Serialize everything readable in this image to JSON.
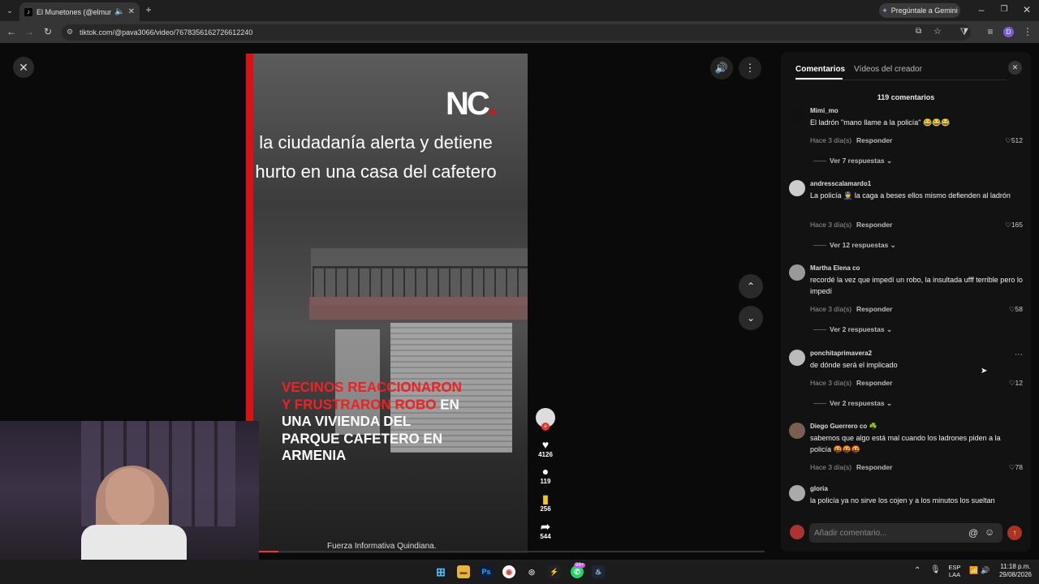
{
  "browser": {
    "tab_title": "El Munetones (@elmunetones)",
    "tab_icon": "tiktok-icon",
    "new_tab": "+",
    "gemini_label": "Pregúntale a Gemini",
    "url": "tiktok.com/@pava3066/video/7678356162726612240",
    "profile_initial": "D"
  },
  "video": {
    "brand_nc": "NC",
    "brand_dot": ".",
    "caption": "la ciudadanía alerta y detiene hurto en una casa del cafetero",
    "headline_red": "VECINOS REACCIONARON Y FRUSTRARON ROBO",
    "headline_white": " EN UNA VIVIENDA DEL PARQUE CAFETERO EN ARMENIA",
    "credit": "Fuerza Informativa Quindiana.",
    "progress_fraction": 0.04,
    "actions": {
      "likes": "4126",
      "comments": "119",
      "saves": "256",
      "shares": "544"
    }
  },
  "panel": {
    "tab_comments": "Comentarios",
    "tab_creator": "Vídeos del creador",
    "count": "119 comentarios",
    "input_placeholder": "Añadir comentario...",
    "reply_label": "Responder",
    "comments": [
      {
        "user": "Mimi_mo",
        "text": "El ladrón \"mano llame a la policía\" 😂😂😂",
        "time": "Hace 3 día(s)",
        "likes": "512",
        "replies": "Ver 7 respuestas"
      },
      {
        "user": "andresscalamardo1",
        "text": "La policía 👮 la caga a beses ellos mismo defienden al ladrón",
        "time": "Hace 3 día(s)",
        "likes": "165",
        "replies": "Ver 12 respuestas"
      },
      {
        "user": "Martha Elena co",
        "text": "recordé la vez que impedí un robo, la insultada ufff terrible pero lo impedí",
        "time": "Hace 3 día(s)",
        "likes": "58",
        "replies": "Ver 2 respuestas"
      },
      {
        "user": "ponchitaprimavera2",
        "text": "de dónde será el implicado",
        "time": "Hace 3 día(s)",
        "likes": "12",
        "replies": "Ver 2 respuestas"
      },
      {
        "user": "Diego Guerrero co ☘️",
        "text": "sabemos que algo está mal cuando los ladrones piden a la policía 🤬🤬🤬",
        "time": "Hace 3 día(s)",
        "likes": "78",
        "replies": ""
      },
      {
        "user": "gloria",
        "text": "la policía ya no sirve los cojen y a los minutos los sueltan",
        "time": "",
        "likes": "",
        "replies": ""
      }
    ]
  },
  "taskbar": {
    "lang_top": "ESP",
    "lang_bottom": "LAA",
    "time": "11:18 p.m.",
    "date": "29/08/2026",
    "badge": "99+"
  },
  "colors": {
    "accent_red": "#dd1111",
    "panel_bg": "#121212"
  }
}
